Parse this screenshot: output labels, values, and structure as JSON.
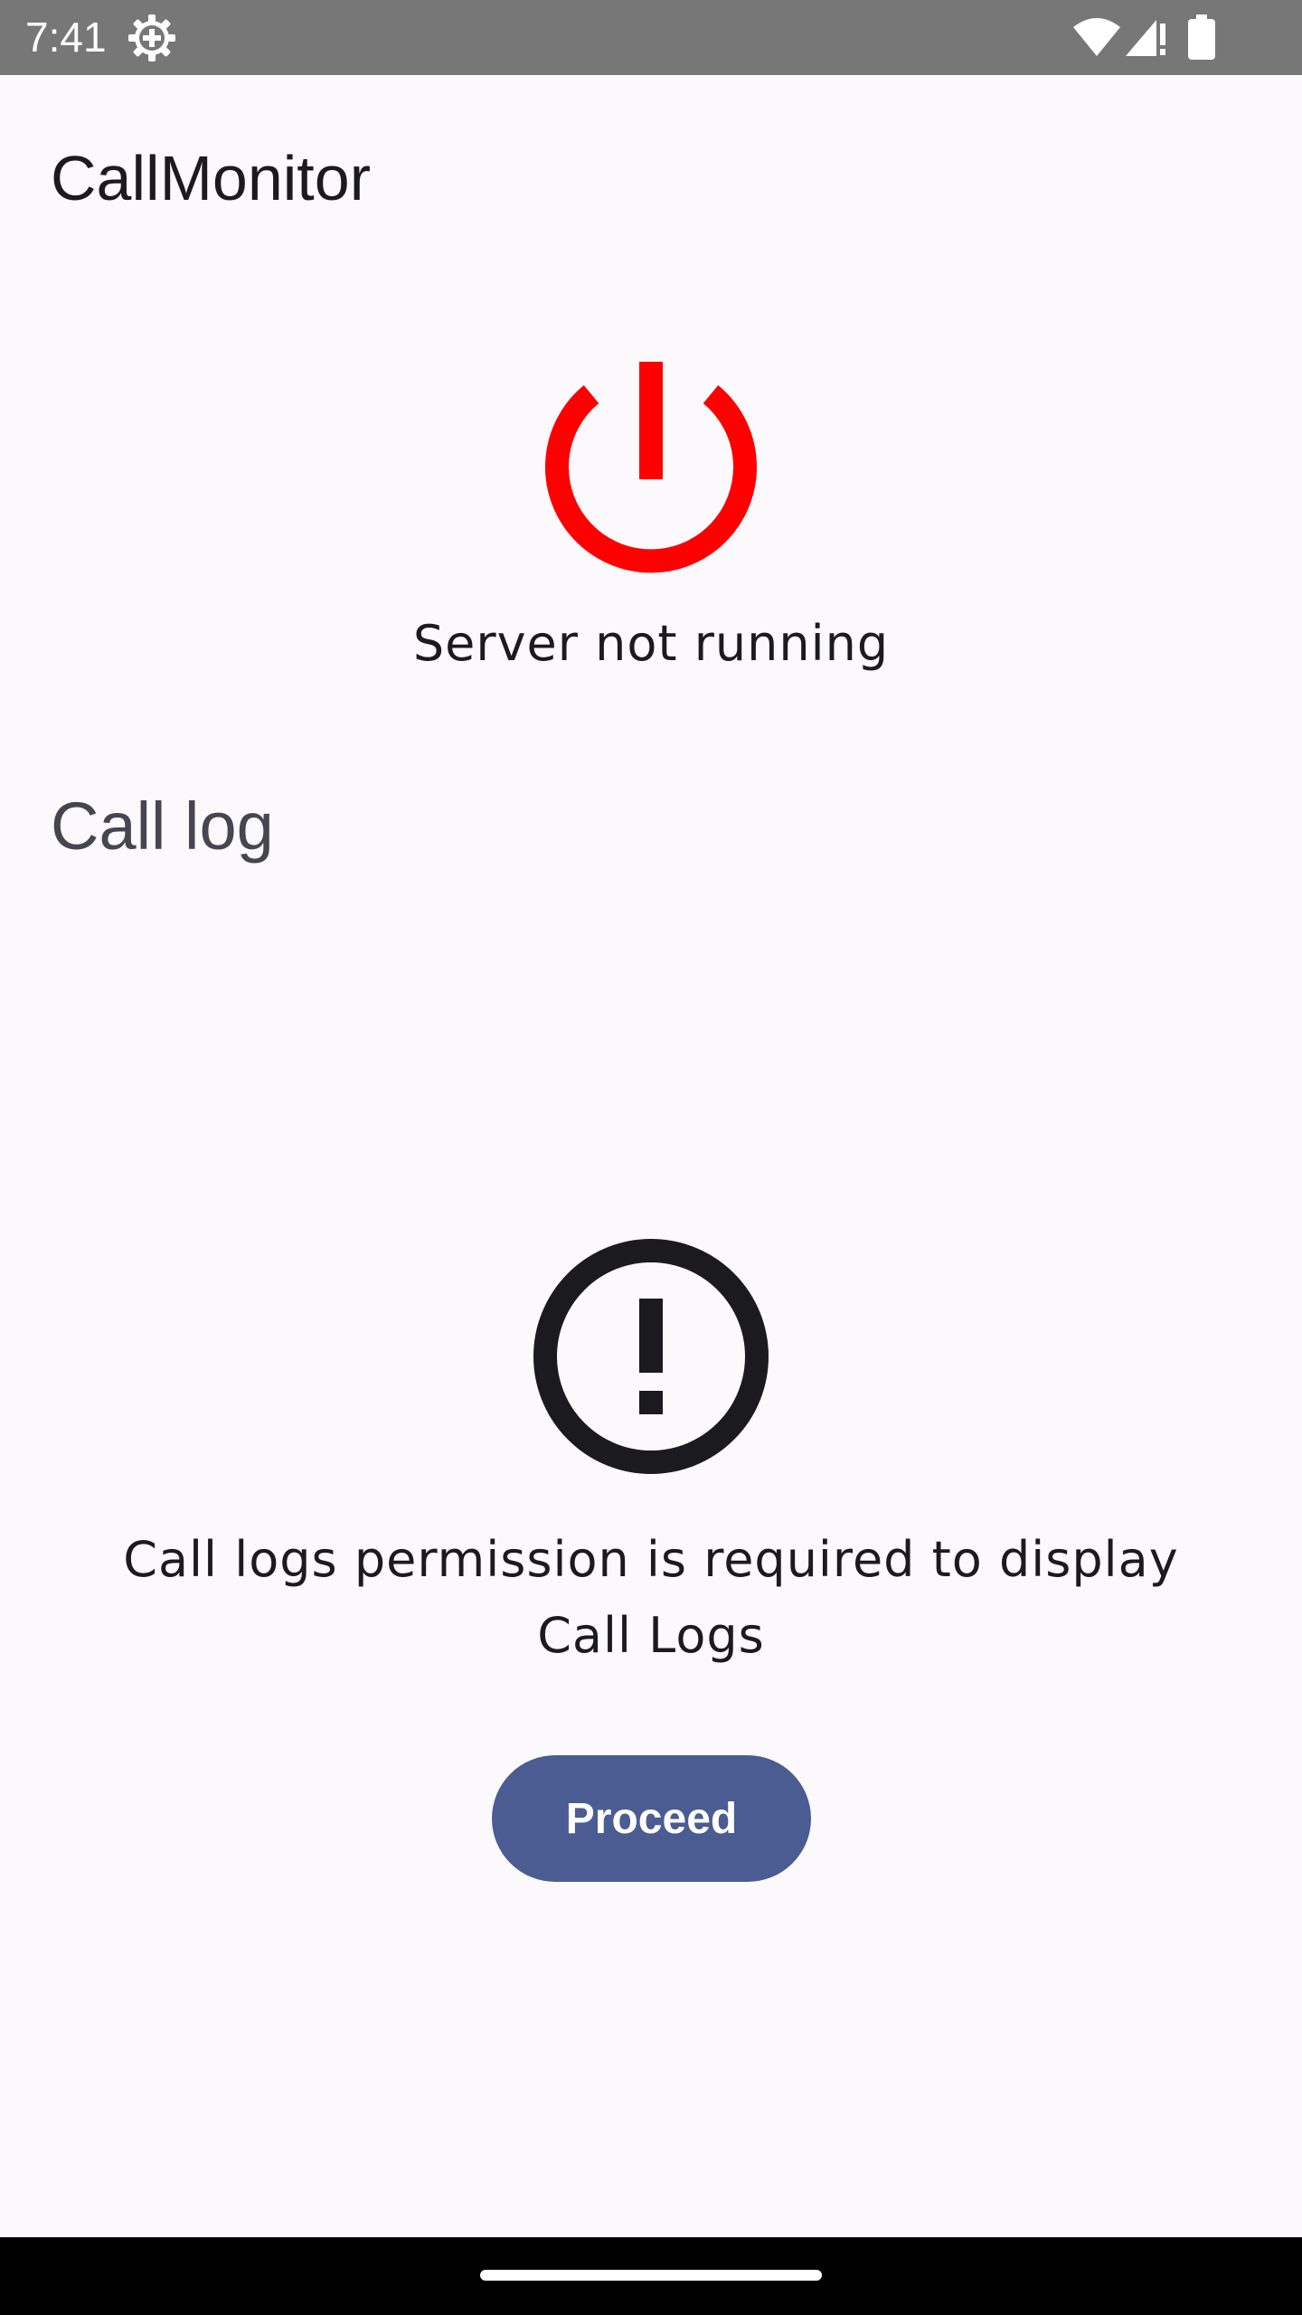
{
  "status_bar": {
    "time": "7:41",
    "icons": [
      "settings-icon",
      "wifi-icon",
      "signal-icon",
      "battery-icon"
    ]
  },
  "app": {
    "title": "CallMonitor"
  },
  "server": {
    "icon": "power-icon",
    "status_text": "Server not running",
    "status_color": "#ff0000"
  },
  "call_log": {
    "section_title": "Call log",
    "icon": "warning-icon",
    "permission_message": "Call logs permission is required to display Call Logs",
    "proceed_label": "Proceed",
    "button_color": "#4b5c92"
  }
}
